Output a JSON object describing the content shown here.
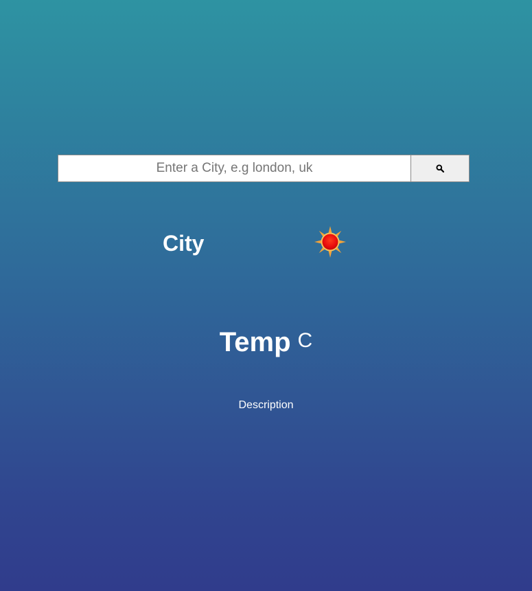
{
  "search": {
    "placeholder": "Enter a City, e.g london, uk",
    "value": "",
    "button_icon": "search-icon"
  },
  "weather": {
    "city": "City",
    "icon": "sun-icon",
    "temp": "Temp",
    "unit": "C",
    "description": "Description"
  },
  "colors": {
    "background_top": "#2e93a2",
    "background_bottom": "#303c8c",
    "text": "#ffffff",
    "sun_core": "#e81010",
    "sun_rays": "#f2a33a"
  }
}
